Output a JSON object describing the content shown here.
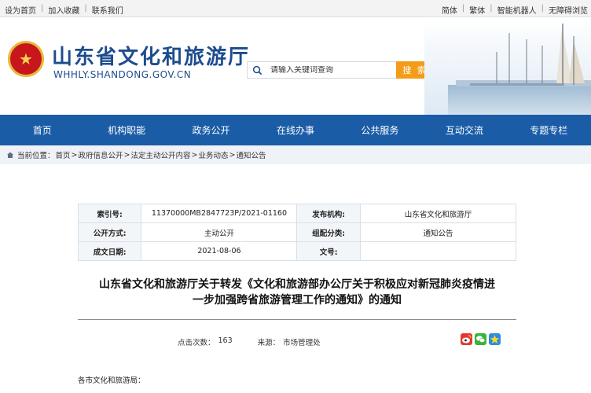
{
  "topbar": {
    "left_links": [
      "设为首页",
      "加入收藏",
      "联系我们"
    ],
    "right_links": [
      "简体",
      "繁体",
      "智能机器人",
      "无障碍浏览"
    ]
  },
  "header": {
    "title": "山东省文化和旅游厅",
    "domain": "WHHLY.SHANDONG.GOV.CN",
    "emblem_icon": "national-emblem-icon",
    "search_placeholder": "请输入关键词查询",
    "search_button": "搜 索",
    "accent_color": "#1d4c8f",
    "search_button_color": "#f39c19"
  },
  "nav": {
    "color": "#1b5ca7",
    "items": [
      "首页",
      "机构职能",
      "政务公开",
      "在线办事",
      "公共服务",
      "互动交流",
      "专题专栏"
    ]
  },
  "breadcrumb": {
    "icon": "home-icon",
    "prefix": "当前位置：",
    "items": [
      "首页",
      "政府信息公开",
      "法定主动公开内容",
      "业务动态",
      "通知公告"
    ]
  },
  "meta": {
    "rows": [
      [
        "索引号:",
        "11370000MB2847723P/2021-01160",
        "发布机构:",
        "山东省文化和旅游厅"
      ],
      [
        "公开方式:",
        "主动公开",
        "组配分类:",
        "通知公告"
      ],
      [
        "成文日期:",
        "2021-08-06",
        "文号:",
        ""
      ]
    ]
  },
  "article": {
    "title_line1": "山东省文化和旅游厅关于转发《文化和旅游部办公厅关于积极应对新冠肺炎疫情进",
    "title_line2": "一步加强跨省旅游管理工作的通知》的通知",
    "clicks_label": "点击次数：",
    "clicks": "163",
    "source_label": "来源：",
    "source": "市场管理处",
    "share_icons": [
      "weibo-icon",
      "wechat-icon",
      "qzone-icon"
    ],
    "salutation": "各市文化和旅游局："
  }
}
